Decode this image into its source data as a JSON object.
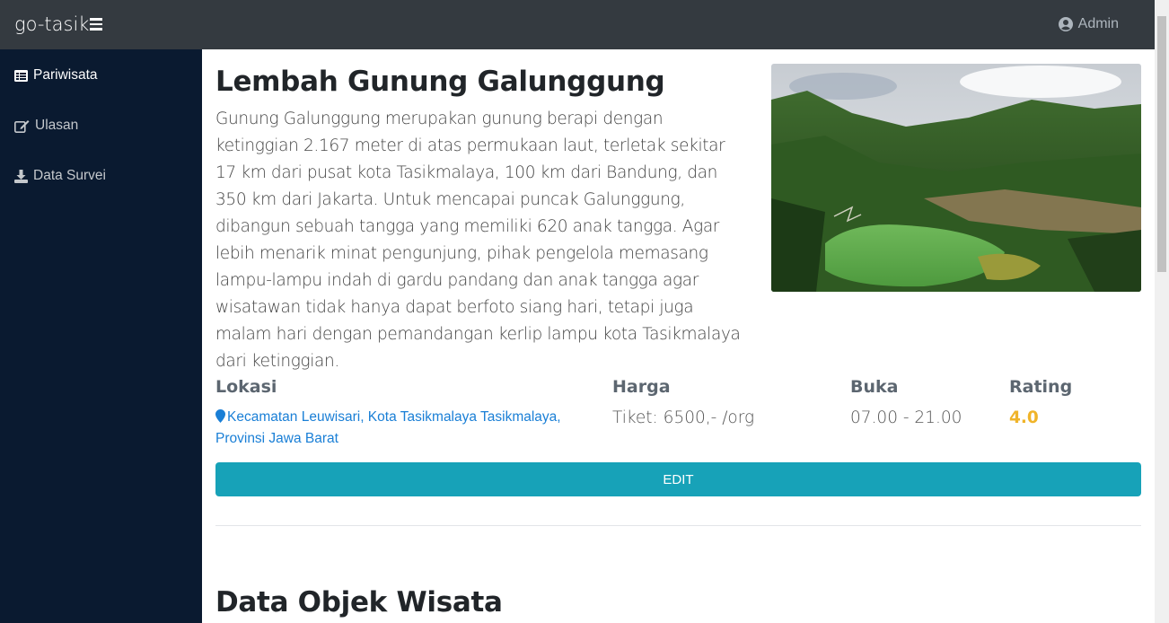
{
  "app": {
    "brand": "go-tasik",
    "user": "Admin"
  },
  "sidebar": {
    "items": [
      {
        "label": "Pariwisata",
        "icon": "table-list-icon",
        "active": true
      },
      {
        "label": "Ulasan",
        "icon": "edit-icon",
        "active": false
      },
      {
        "label": "Data Survei",
        "icon": "download-icon",
        "active": false
      }
    ]
  },
  "detail": {
    "title": "Lembah Gunung Galunggung",
    "description": "Gunung Galunggung merupakan gunung berapi dengan ketinggian 2.167 meter di atas permukaan laut, terletak sekitar 17 km dari pusat kota Tasikmalaya, 100 km dari Bandung, dan 350 km dari Jakarta. Untuk mencapai puncak Galunggung, dibangun sebuah tangga yang memiliki 620 anak tangga. Agar lebih menarik minat pengunjung, pihak pengelola memasang lampu-lampu indah di gardu pandang dan anak tangga agar wisatawan tidak hanya dapat berfoto siang hari, tetapi juga malam hari dengan pemandangan kerlip lampu kota Tasikmalaya dari ketinggian.",
    "lokasi_label": "Lokasi",
    "lokasi_value": "Kecamatan Leuwisari, Kota Tasikmalaya Tasikmalaya, Provinsi Jawa Barat",
    "harga_label": "Harga",
    "harga_value": "Tiket: 6500,- /org",
    "buka_label": "Buka",
    "buka_value": "07.00 - 21.00",
    "rating_label": "Rating",
    "rating_value": "4.0",
    "edit_label": "EDIT"
  },
  "section": {
    "title": "Data Objek Wisata"
  },
  "colors": {
    "topbar": "#343a40",
    "sidebar": "#0a1a30",
    "accent": "#17a2b8",
    "link": "#1a7fd6",
    "rating": "#f0b429"
  }
}
